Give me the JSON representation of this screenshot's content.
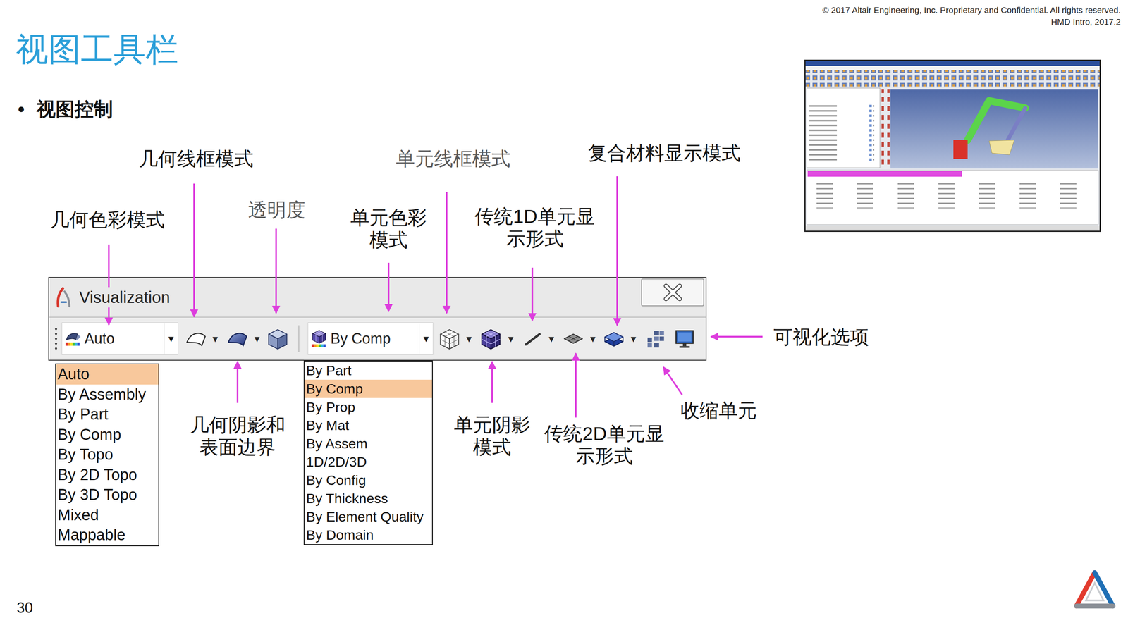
{
  "header": {
    "copyright": "© 2017 Altair Engineering, Inc. Proprietary and Confidential. All rights reserved.",
    "course": "HMD Intro, 2017.2"
  },
  "title": "视图工具栏",
  "bullet": {
    "mark": "•",
    "text": "视图控制"
  },
  "toolbar": {
    "title": "Visualization",
    "geometry_color": {
      "value": "Auto",
      "arrow": "▼"
    },
    "geometry_wireframe": {
      "arrow": "▾"
    },
    "geometry_shaded": {
      "arrow": "▾"
    },
    "element_color": {
      "value": "By Comp",
      "arrow": "▼"
    },
    "element_wireframe": {
      "arrow": "▾"
    },
    "element_shaded": {
      "arrow": "▾"
    },
    "legacy_1d": {
      "arrow": "▾"
    },
    "legacy_2d": {
      "arrow": "▾"
    },
    "composite": {
      "arrow": "▾"
    }
  },
  "geometry_color_menu": [
    {
      "label": "Auto",
      "selected": true
    },
    {
      "label": "By Assembly",
      "selected": false
    },
    {
      "label": "By Part",
      "selected": false
    },
    {
      "label": "By Comp",
      "selected": false
    },
    {
      "label": "By Topo",
      "selected": false
    },
    {
      "label": "By 2D Topo",
      "selected": false
    },
    {
      "label": "By 3D Topo",
      "selected": false
    },
    {
      "label": "Mixed",
      "selected": false
    },
    {
      "label": "Mappable",
      "selected": false
    }
  ],
  "element_color_menu": [
    {
      "label": "By Part",
      "selected": false
    },
    {
      "label": "By Comp",
      "selected": true
    },
    {
      "label": "By Prop",
      "selected": false
    },
    {
      "label": "By Mat",
      "selected": false
    },
    {
      "label": "By Assem",
      "selected": false
    },
    {
      "label": "1D/2D/3D",
      "selected": false
    },
    {
      "label": "By Config",
      "selected": false
    },
    {
      "label": "By Thickness",
      "selected": false
    },
    {
      "label": "By Element Quality",
      "selected": false
    },
    {
      "label": "By Domain",
      "selected": false
    }
  ],
  "annotations": [
    {
      "lines": [
        "几何色彩模式"
      ],
      "color": "#111111"
    },
    {
      "lines": [
        "几何线框模式"
      ],
      "color": "#111111"
    },
    {
      "lines": [
        "透明度"
      ],
      "color": "#595959"
    },
    {
      "lines": [
        "单元色彩",
        "模式"
      ],
      "color": "#111111"
    },
    {
      "lines": [
        "单元线框模式"
      ],
      "color": "#595959"
    },
    {
      "lines": [
        "传统1D单元显",
        "示形式"
      ],
      "color": "#111111"
    },
    {
      "lines": [
        "复合材料显示模式"
      ],
      "color": "#111111"
    },
    {
      "lines": [
        "可视化选项"
      ],
      "color": "#111111"
    },
    {
      "lines": [
        "几何阴影和",
        "表面边界"
      ],
      "color": "#111111"
    },
    {
      "lines": [
        "单元阴影",
        "模式"
      ],
      "color": "#111111"
    },
    {
      "lines": [
        "传统2D单元显",
        "示形式"
      ],
      "color": "#111111"
    },
    {
      "lines": [
        "收缩单元"
      ],
      "color": "#111111"
    }
  ],
  "page_number": "30"
}
